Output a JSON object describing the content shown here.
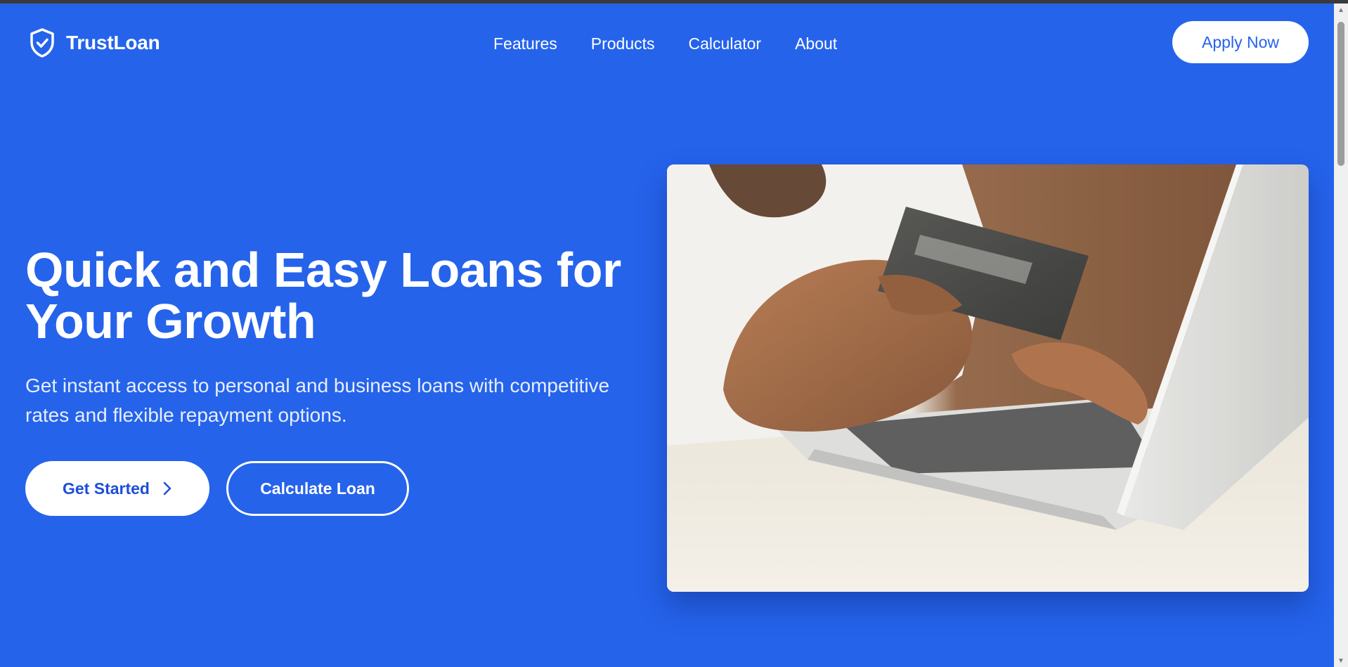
{
  "brand": {
    "name": "TrustLoan",
    "logo_icon": "shield-check-icon",
    "primary_color": "#2563eb",
    "button_text_color": "#1d4ed8"
  },
  "nav": {
    "items": [
      {
        "label": "Features"
      },
      {
        "label": "Products"
      },
      {
        "label": "Calculator"
      },
      {
        "label": "About"
      }
    ]
  },
  "header": {
    "cta_label": "Apply Now"
  },
  "hero": {
    "title_line1": "Quick and Easy Loans for",
    "title_line2": "Your Growth",
    "subtitle_line1": "Get instant access to personal and business loans with competitive",
    "subtitle_line2": "rates and flexible repayment options.",
    "primary_button": "Get Started",
    "primary_button_icon": "chevron-right-icon",
    "secondary_button": "Calculate Loan",
    "image_alt": "Person holding a credit card while using a laptop"
  }
}
